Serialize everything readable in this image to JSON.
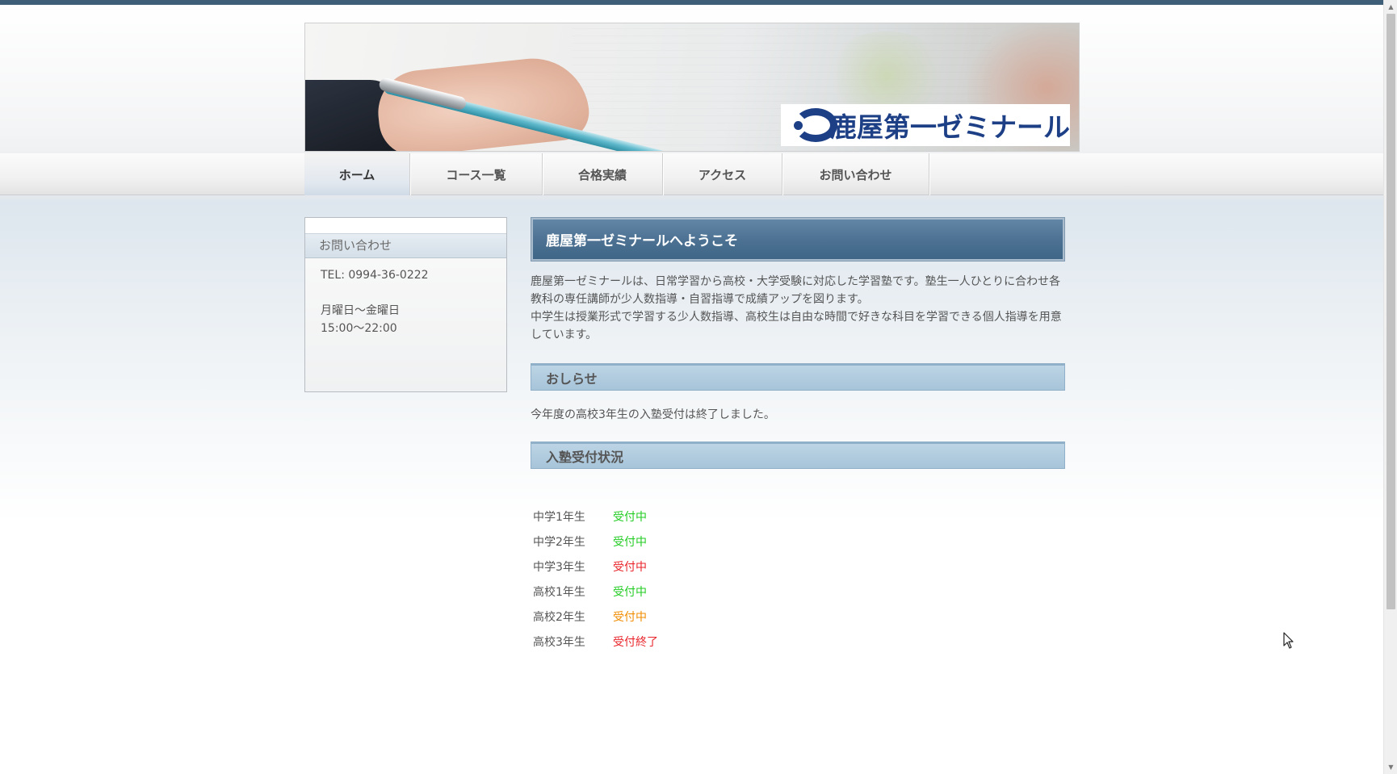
{
  "header": {
    "logo_text": "鹿屋第一ゼミナール"
  },
  "nav": {
    "items": [
      {
        "label": "ホーム",
        "active": true
      },
      {
        "label": "コース一覧",
        "active": false
      },
      {
        "label": "合格実績",
        "active": false
      },
      {
        "label": "アクセス",
        "active": false
      },
      {
        "label": "お問い合わせ",
        "active": false
      }
    ]
  },
  "sidebar": {
    "title": "お問い合わせ",
    "tel": "TEL: 0994-36-0222",
    "days": "月曜日～金曜日",
    "hours": "15:00～22:00"
  },
  "main": {
    "welcome_title": "鹿屋第一ゼミナールへようこそ",
    "intro_line1": "鹿屋第一ゼミナールは、日常学習から高校・大学受験に対応した学習塾です。塾生一人ひとりに合わせ各教科の専任講師が少人数指導・自習指導で成績アップを図ります。",
    "intro_line2": "中学生は授業形式で学習する少人数指導、高校生は自由な時間で好きな科目を学習できる個人指導を用意しています。",
    "notice_title": "おしらせ",
    "notice_text": "今年度の高校3年生の入塾受付は終了しました。",
    "status_title": "入塾受付状況",
    "status_rows": [
      {
        "grade": "中学1年生",
        "status": "受付中",
        "color": "#22cc22"
      },
      {
        "grade": "中学2年生",
        "status": "受付中",
        "color": "#22cc22"
      },
      {
        "grade": "中学3年生",
        "status": "受付中",
        "color": "#e8242a"
      },
      {
        "grade": "高校1年生",
        "status": "受付中",
        "color": "#22cc22"
      },
      {
        "grade": "高校2年生",
        "status": "受付中",
        "color": "#f08c00"
      },
      {
        "grade": "高校3年生",
        "status": "受付終了",
        "color": "#e8242a"
      }
    ]
  },
  "colors": {
    "topbar": "#3f5f78",
    "logo_blue": "#1d3f86",
    "welcome_bg": "#4d7293",
    "section_bg": "#a7c4d9"
  },
  "icons": {
    "scroll_up": "scroll-up-arrow-icon",
    "scroll_down": "scroll-down-arrow-icon",
    "cursor": "mouse-pointer-icon"
  }
}
